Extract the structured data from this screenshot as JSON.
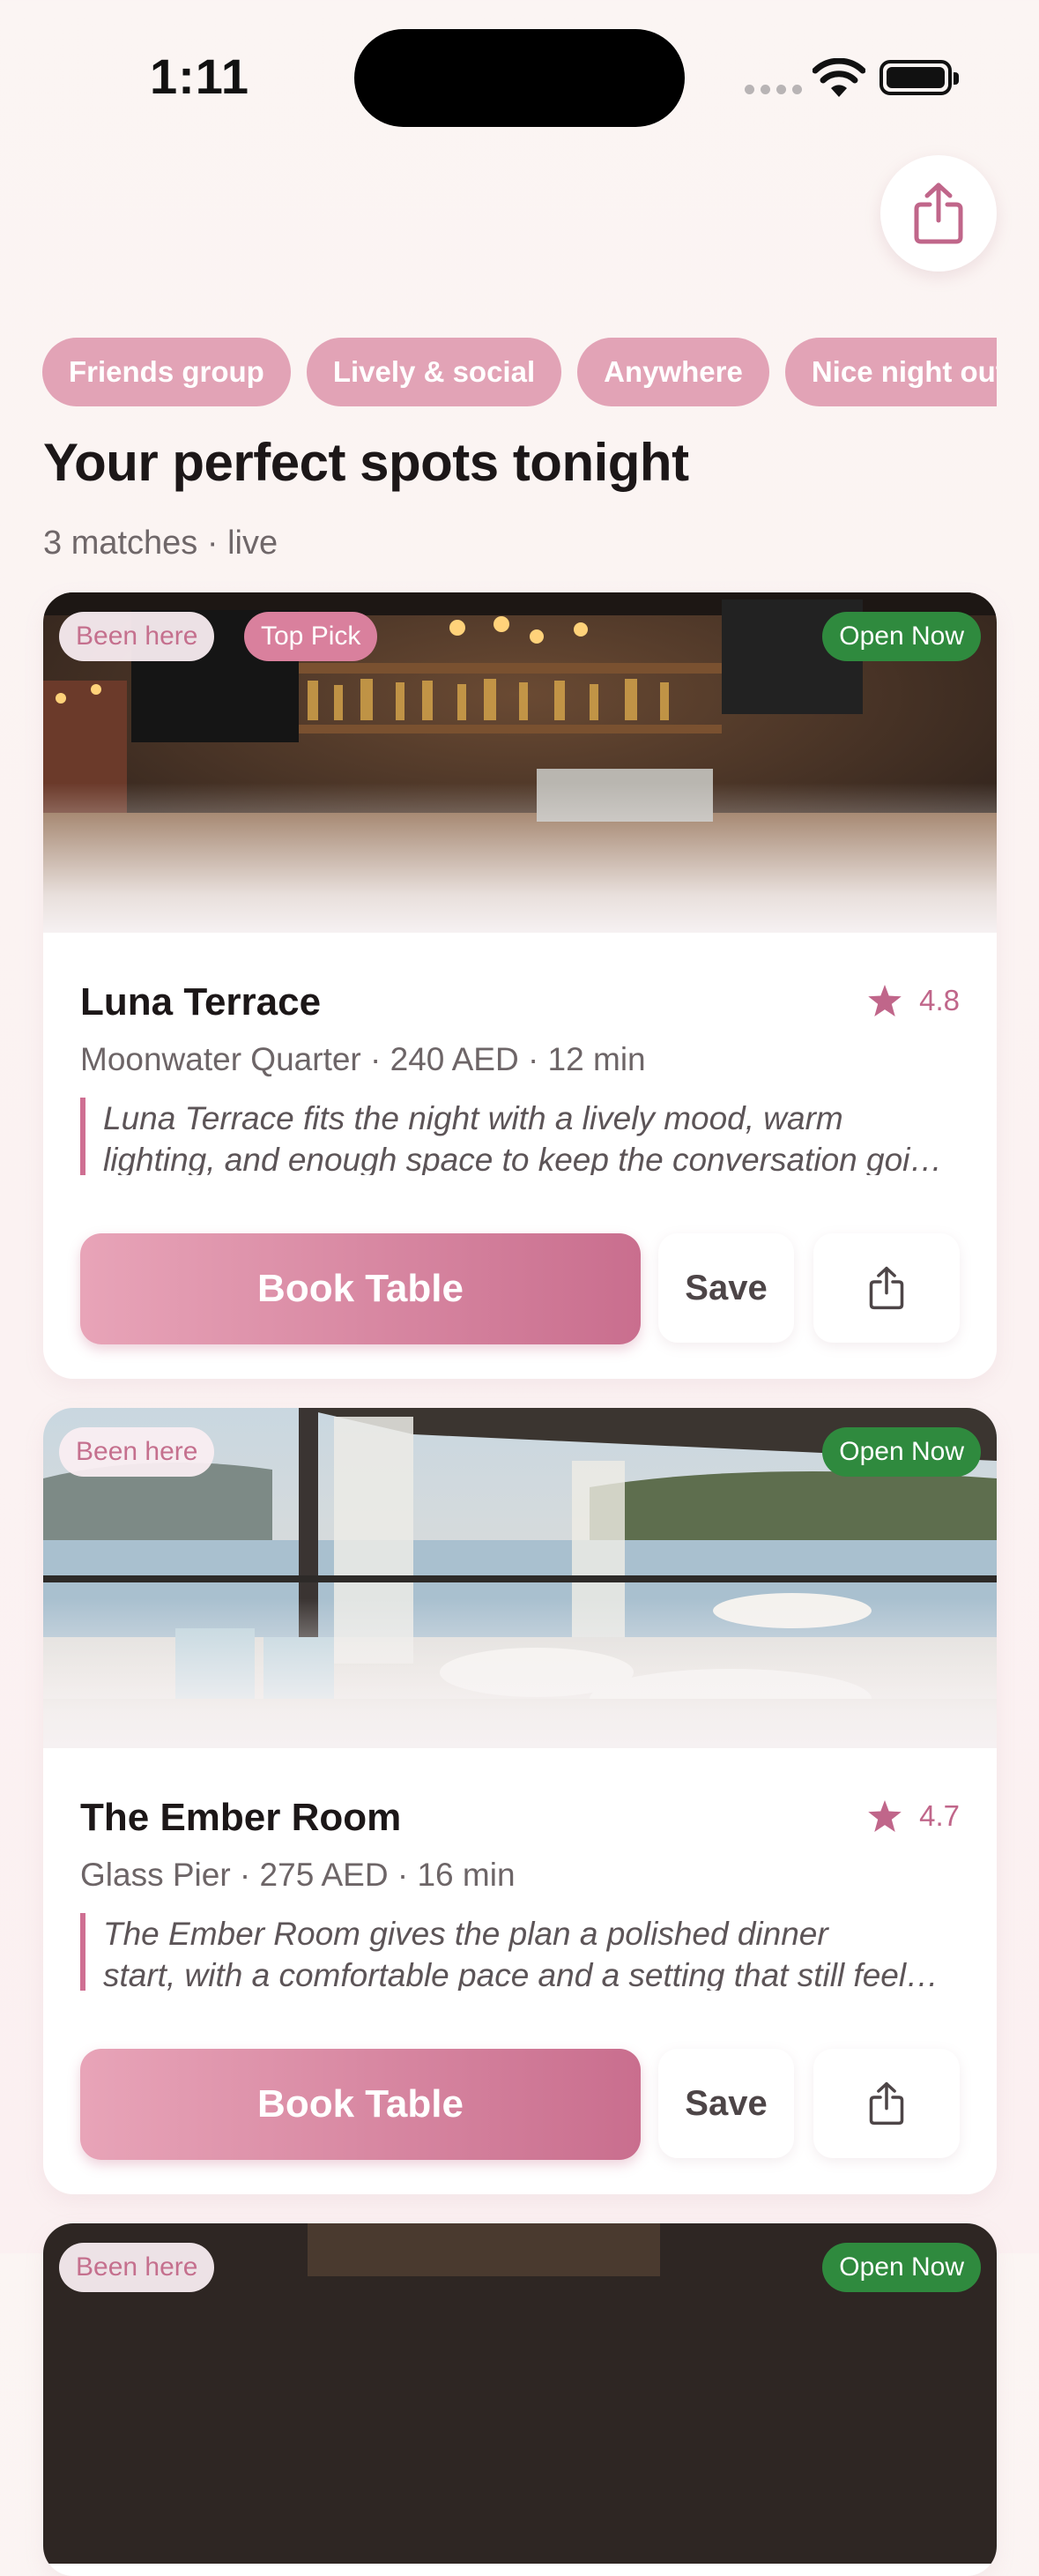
{
  "status_bar": {
    "time": "1:11"
  },
  "filters": [
    "Friends group",
    "Lively & social",
    "Anywhere",
    "Nice night out"
  ],
  "heading": "Your perfect spots tonight",
  "subheading": "3 matches · live",
  "cards": [
    {
      "badges": [
        "Been here",
        "Top Pick"
      ],
      "status": "Open Now",
      "name": "Luna Terrace",
      "rating": "4.8",
      "meta": "Moonwater Quarter · 240 AED · 12 min",
      "desc_line1": "Luna Terrace fits the night with a lively mood, warm",
      "desc_line2": "lighting, and enough space to keep the conversation going.",
      "book_label": "Book Table",
      "save_label": "Save"
    },
    {
      "badges": [
        "Been here"
      ],
      "status": "Open Now",
      "name": "The Ember Room",
      "rating": "4.7",
      "meta": "Glass Pier · 275 AED · 16 min",
      "desc_line1": "The Ember Room gives the plan a polished dinner",
      "desc_line2": "start, with a comfortable pace and a setting that still feels special.",
      "book_label": "Book Table",
      "save_label": "Save"
    },
    {
      "badges": [
        "Been here"
      ],
      "status": "Open Now"
    }
  ],
  "colors": {
    "accent": "#d9809d",
    "open": "#2f8a3e",
    "star": "#c0668a"
  }
}
